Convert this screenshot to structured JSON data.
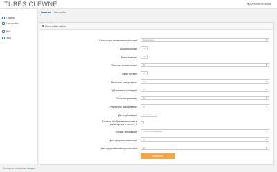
{
  "app": {
    "brand": "TUBES CLEWNE",
    "user_menu": "▾ Дополнительные"
  },
  "sidebar": {
    "items": [
      {
        "label": "Панель",
        "icon": "dashboard-icon"
      },
      {
        "label": "Настройки",
        "icon": "settings-icon"
      },
      {
        "label": "Веб",
        "icon": "web-icon"
      },
      {
        "label": "Фид",
        "icon": "feed-icon"
      }
    ]
  },
  "tabs": [
    {
      "label": "Главная"
    },
    {
      "label": "Настройки"
    }
  ],
  "panel": {
    "title": "Настройки сайта"
  },
  "form": {
    "rows": [
      {
        "label": "Частота при переключении ссылки",
        "type": "select",
        "value": "Выключено"
      },
      {
        "label": "Ширина иконки",
        "type": "input",
        "value": "100"
      },
      {
        "label": "Высота иконки",
        "type": "input",
        "value": "100"
      },
      {
        "label": "Показать кнопки записи",
        "type": "select",
        "value": "Да"
      },
      {
        "label": "Лимит превью",
        "type": "input",
        "value": "10"
      },
      {
        "label": "Включить кеширование",
        "type": "select",
        "value": "Нет"
      },
      {
        "label": "Публиковать последний",
        "type": "select",
        "value": "Да"
      },
      {
        "label": "Показать разметку",
        "type": "select",
        "value": "Да"
      },
      {
        "label": "Отключить кеширование",
        "type": "select",
        "value": "Да"
      },
      {
        "label": "Дата публикации",
        "type": "input",
        "value": "d.m.Y H:i"
      },
      {
        "label": "Показать изображение ссылки и размещения в ленте: +X",
        "type": "check",
        "value": ""
      },
      {
        "label": "Формат публикации",
        "type": "select",
        "value": "Только изображения"
      },
      {
        "label": "Цвет оформления ссылки",
        "type": "select",
        "value": "Да"
      },
      {
        "label": "Цвет оформления второго ссылки",
        "type": "select",
        "value": "Да"
      }
    ]
  },
  "actions": {
    "save": "Сохранить"
  },
  "footer": {
    "text": "Последнее изменение:",
    "value": "сегодня"
  }
}
